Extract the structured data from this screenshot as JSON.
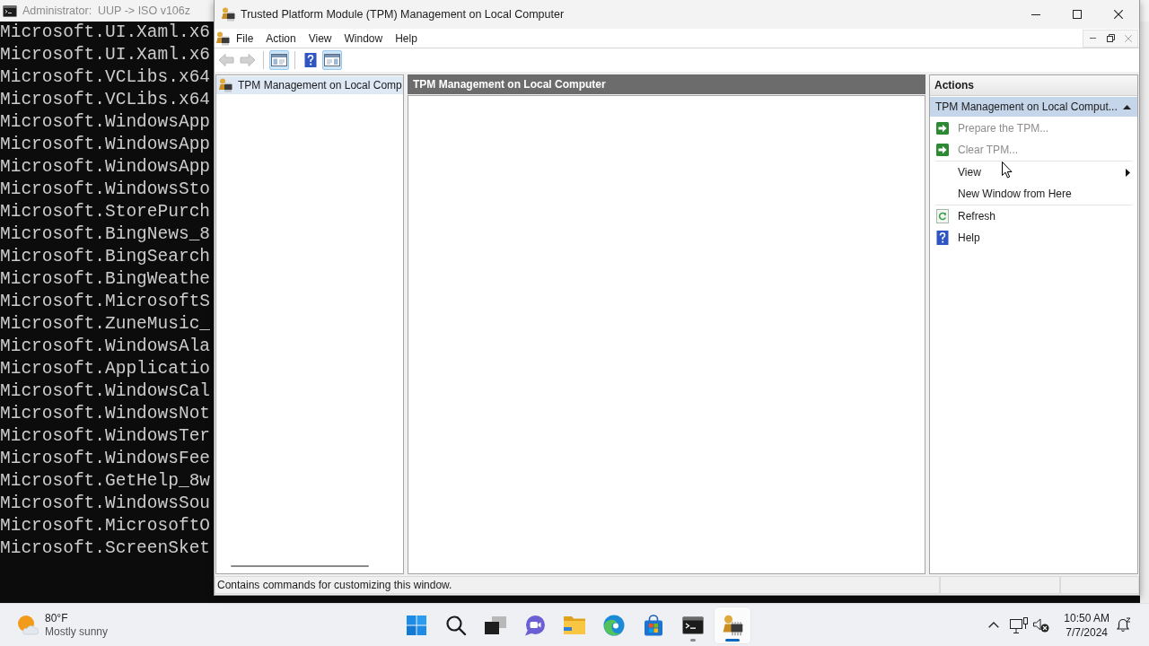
{
  "console": {
    "title": "Administrator:  UUP -> ISO v106z",
    "lines": [
      "Microsoft.UI.Xaml.x6",
      "Microsoft.UI.Xaml.x6",
      "Microsoft.VCLibs.x64",
      "Microsoft.VCLibs.x64",
      "Microsoft.WindowsApp",
      "Microsoft.WindowsApp",
      "Microsoft.WindowsApp",
      "Microsoft.WindowsSto",
      "Microsoft.StorePurch",
      "Microsoft.BingNews_8",
      "Microsoft.BingSearch",
      "Microsoft.BingWeathe",
      "Microsoft.MicrosoftS",
      "Microsoft.ZuneMusic_",
      "Microsoft.WindowsAla",
      "Microsoft.Applicatio",
      "Microsoft.WindowsCal",
      "Microsoft.WindowsNot",
      "Microsoft.WindowsTer",
      "Microsoft.WindowsFee",
      "Microsoft.GetHelp_8w",
      "Microsoft.WindowsSou",
      "Microsoft.MicrosoftO",
      "Microsoft.ScreenSket"
    ]
  },
  "window": {
    "title": "Trusted Platform Module (TPM) Management on Local Computer"
  },
  "menu": [
    "File",
    "Action",
    "View",
    "Window",
    "Help"
  ],
  "toolbar": {
    "groups": [
      {
        "buttons": [
          {
            "kind": "back",
            "disabled": true,
            "pressed": false
          },
          {
            "kind": "forward",
            "disabled": true,
            "pressed": false
          }
        ]
      },
      {
        "buttons": [
          {
            "kind": "tree-toggle",
            "disabled": false,
            "pressed": true
          }
        ]
      },
      {
        "buttons": [
          {
            "kind": "help",
            "disabled": false,
            "pressed": false
          },
          {
            "kind": "action-toggle",
            "disabled": false,
            "pressed": true
          }
        ]
      }
    ]
  },
  "tree": {
    "items": [
      {
        "label": "TPM Management on Local Comp",
        "selected": true
      }
    ]
  },
  "details": {
    "header": "TPM Management on Local Computer"
  },
  "actions": {
    "title": "Actions",
    "section": {
      "label": "TPM Management on Local Comput...",
      "expanded": true
    },
    "groups": [
      {
        "items": [
          {
            "label": "Prepare the TPM...",
            "kind": "run",
            "disabled": true
          },
          {
            "label": "Clear TPM...",
            "kind": "run",
            "disabled": true
          }
        ]
      },
      {
        "items": [
          {
            "label": "View",
            "kind": "submenu",
            "disabled": false
          },
          {
            "label": "New Window from Here",
            "kind": "plain",
            "disabled": false
          }
        ]
      },
      {
        "items": [
          {
            "label": "Refresh",
            "kind": "refresh",
            "disabled": false
          },
          {
            "label": "Help",
            "kind": "help",
            "disabled": false
          }
        ]
      }
    ]
  },
  "status_bar": {
    "text": "Contains commands for customizing this window."
  },
  "taskbar": {
    "weather": {
      "temperature": "80°F",
      "condition": "Mostly sunny"
    },
    "apps": [
      {
        "kind": "start",
        "running": false,
        "selected": false
      },
      {
        "kind": "search",
        "running": false,
        "selected": false
      },
      {
        "kind": "task-view",
        "running": false,
        "selected": false
      },
      {
        "kind": "chat",
        "running": false,
        "selected": false
      },
      {
        "kind": "folder",
        "running": false,
        "selected": false
      },
      {
        "kind": "browser",
        "running": false,
        "selected": false
      },
      {
        "kind": "store",
        "running": false,
        "selected": false
      },
      {
        "kind": "console",
        "running": true,
        "selected": false
      },
      {
        "kind": "mmc",
        "running": true,
        "selected": true
      }
    ],
    "clock": {
      "time": "10:50 AM",
      "date": "7/7/2024"
    }
  }
}
